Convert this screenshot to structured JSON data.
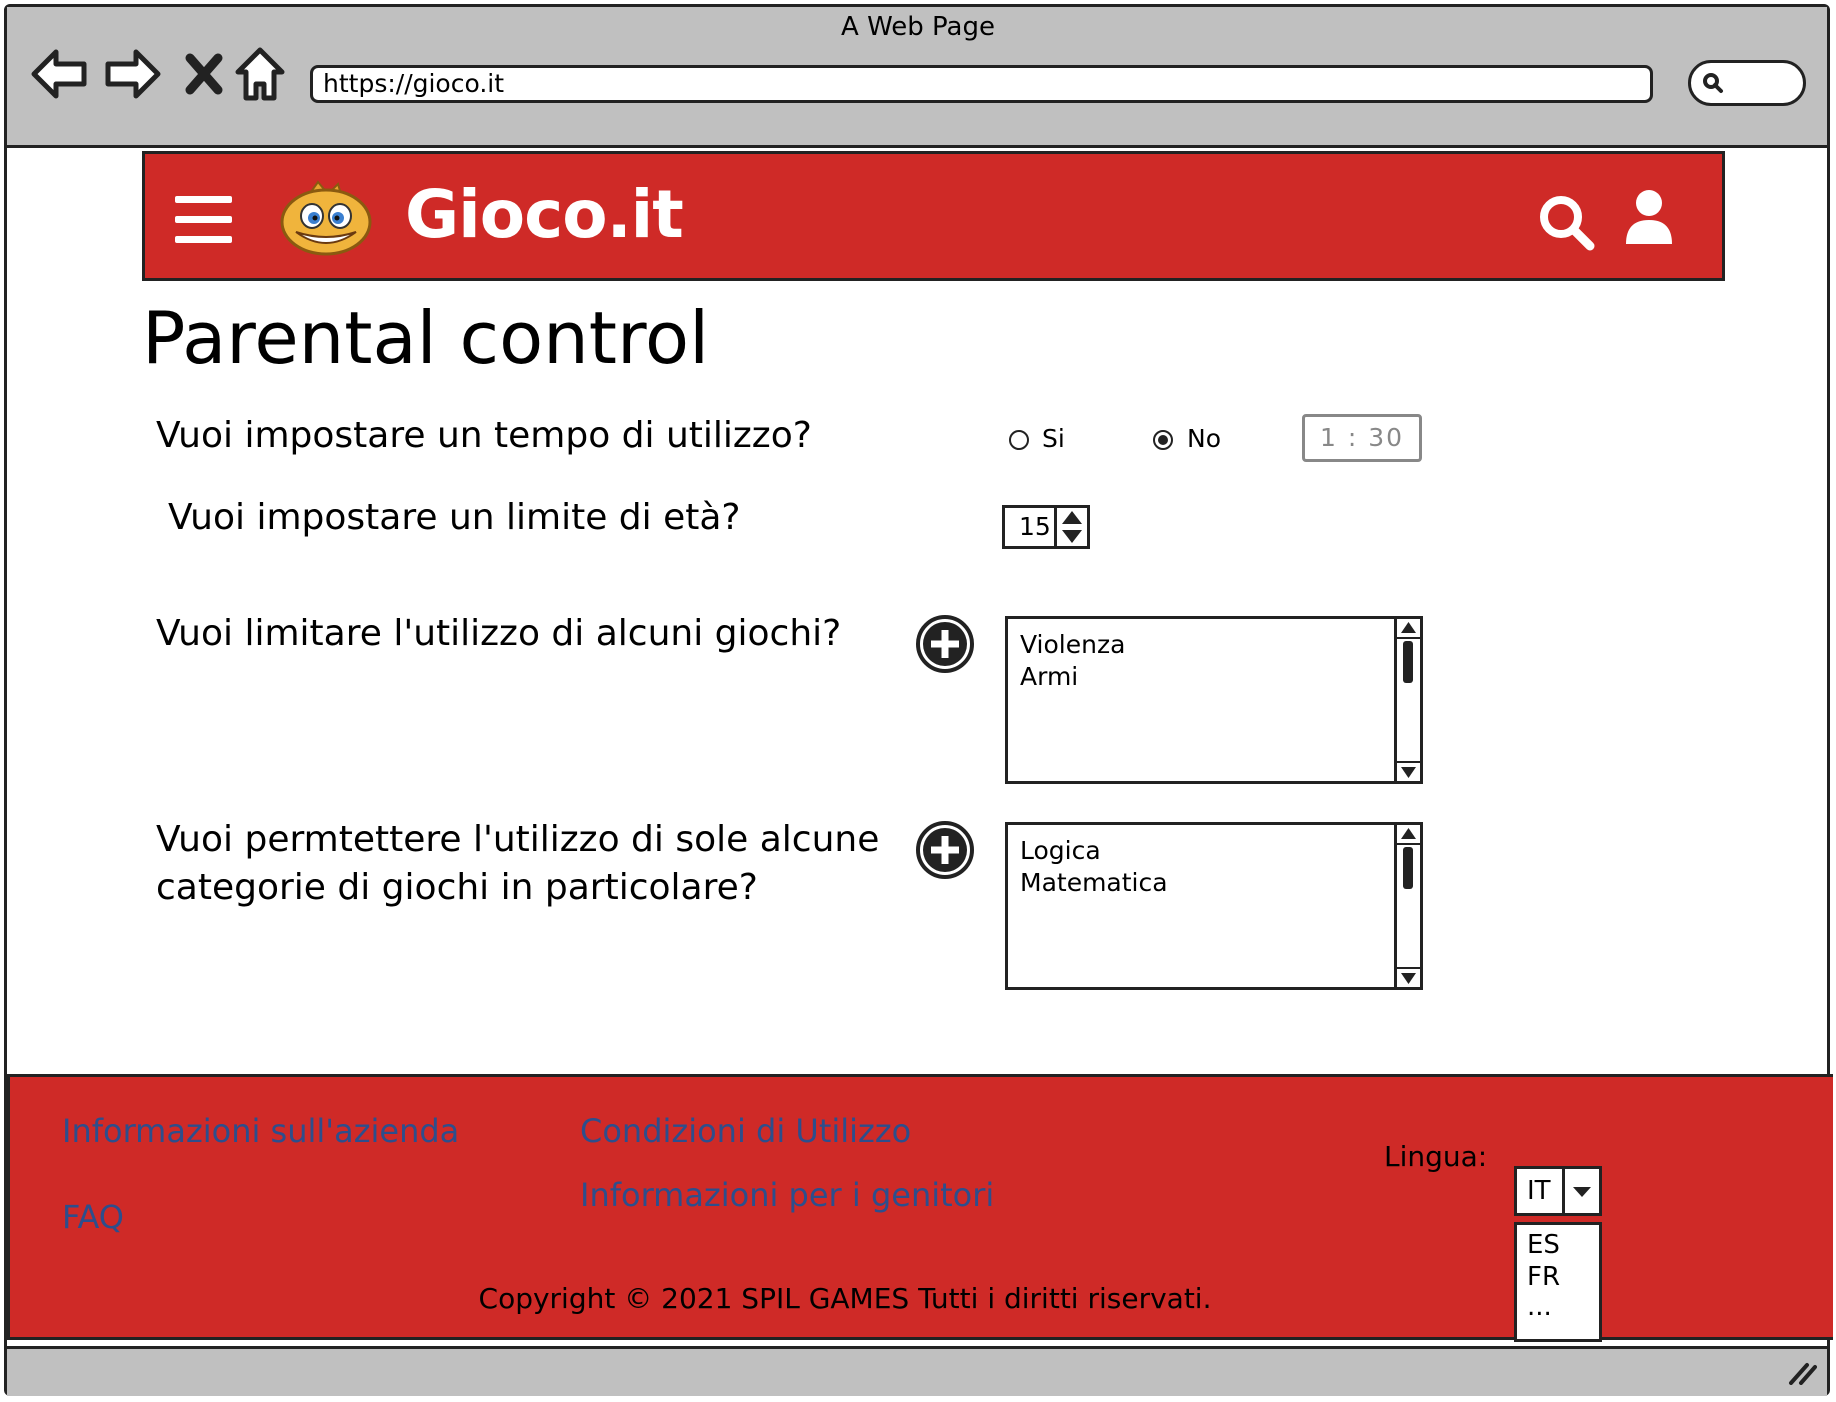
{
  "browser": {
    "window_title": "A Web Page",
    "url": "https://gioco.it"
  },
  "header": {
    "brand": "Gioco.it",
    "accent_color": "#cf2a27"
  },
  "page": {
    "title": "Parental control",
    "questions": {
      "time": "Vuoi impostare un tempo di utilizzo?",
      "age": "Vuoi impostare un limite di età?",
      "limit_games": "Vuoi limitare l'utilizzo di alcuni giochi?",
      "allow_categories": "Vuoi permtettere l'utilizzo di sole alcune categorie di giochi in particolare?"
    },
    "time_options": {
      "yes_label": "Si",
      "no_label": "No",
      "selected": "No"
    },
    "time_value": "1 :  30",
    "age_value": "15",
    "blocked_list": [
      "Violenza",
      "Armi"
    ],
    "allowed_list": [
      "Logica",
      "Matematica"
    ]
  },
  "footer": {
    "links": {
      "company_info": "Informazioni sull'azienda",
      "faq": "FAQ",
      "terms": "Condizioni di Utilizzo",
      "parents_info": "Informazioni per i genitori"
    },
    "language_label": "Lingua:",
    "language_selected": "IT",
    "language_options": [
      "ES",
      "FR",
      "..."
    ],
    "copyright": "Copyright © 2021 SPIL GAMES Tutti i diritti riservati.",
    "link_color": "#2d4e8c"
  }
}
